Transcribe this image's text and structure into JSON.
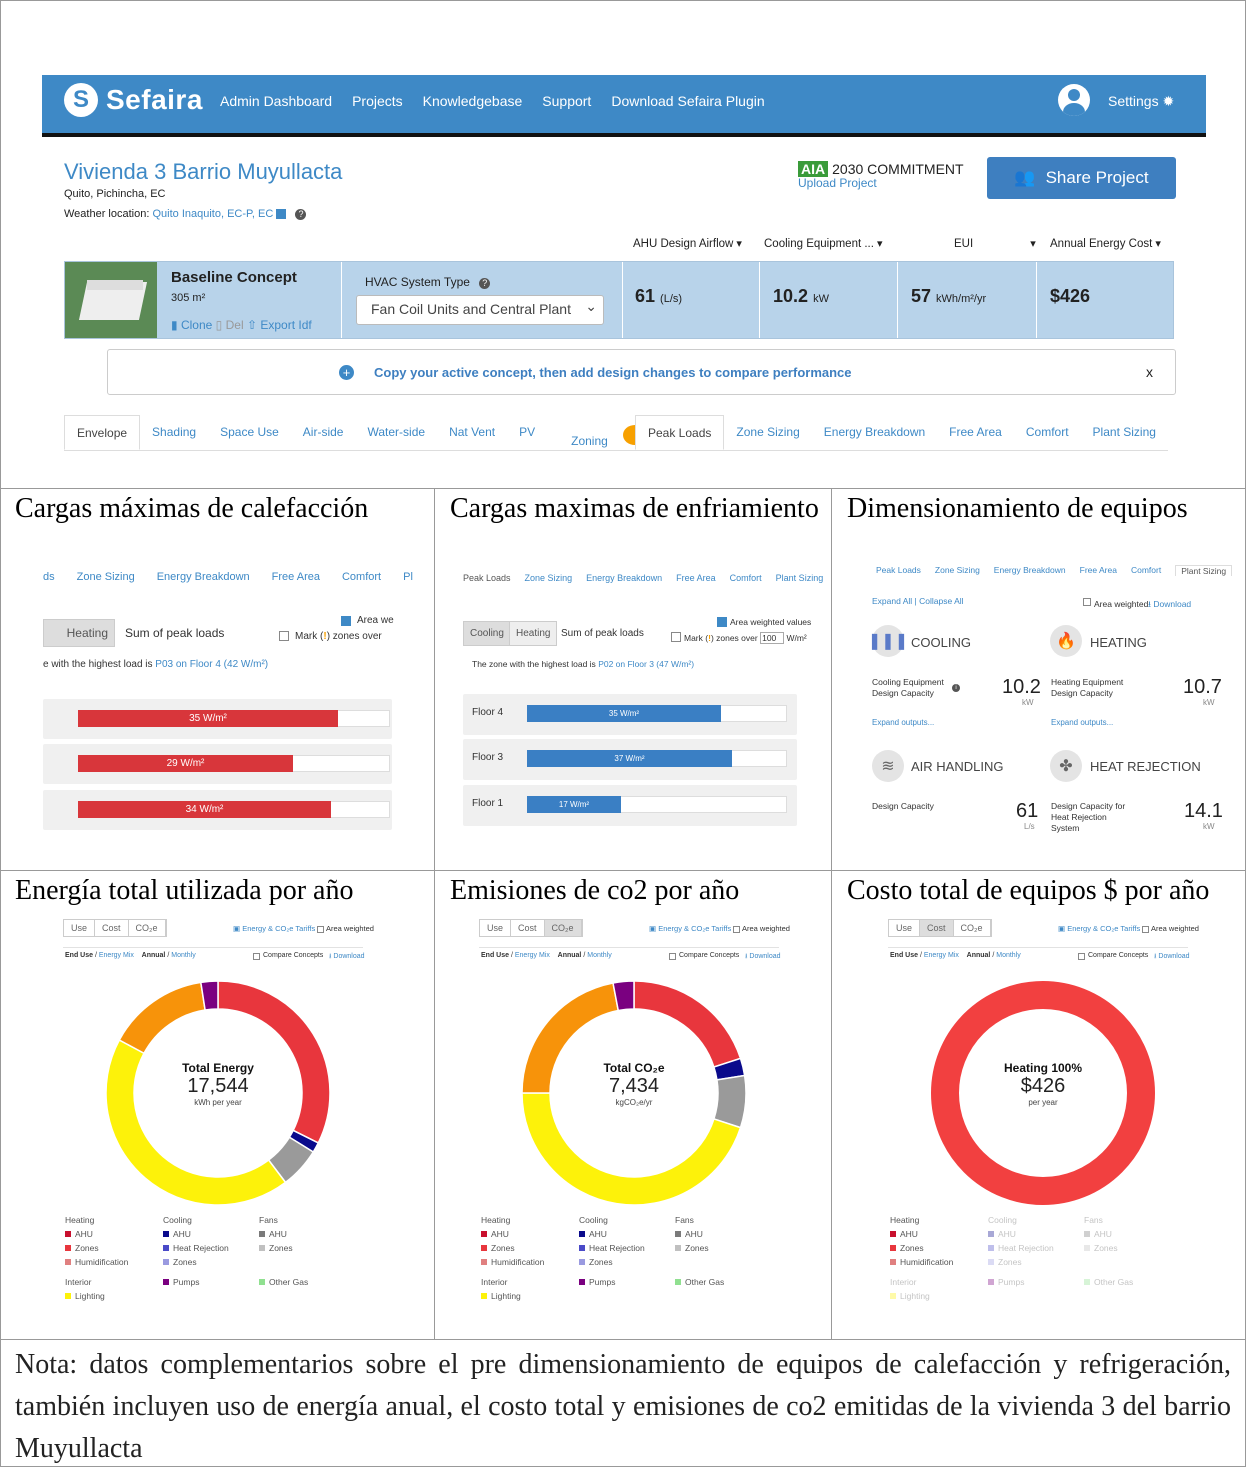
{
  "nav": {
    "brand": "Sefaira",
    "links": [
      "Admin Dashboard",
      "Projects",
      "Knowledgebase",
      "Support",
      "Download Sefaira Plugin"
    ],
    "settings": "Settings"
  },
  "project": {
    "title": "Vivienda 3 Barrio Muyullacta",
    "location": "Quito, Pichincha, EC",
    "weather_label": "Weather location:",
    "weather_value": "Quito Inaquito, EC-P, EC",
    "aia_badge": "AIA",
    "aia_text": "2030 COMMITMENT",
    "upload": "Upload Project",
    "share": "Share Project"
  },
  "metrics_headers": [
    "AHU Design Airflow",
    "Cooling Equipment ...",
    "EUI",
    "Annual Energy Cost"
  ],
  "concept": {
    "name": "Baseline Concept",
    "area": "305 m²",
    "clone": "Clone",
    "del": "Del",
    "export": "Export Idf",
    "hvac_label": "HVAC System Type",
    "hvac_value": "Fan Coil Units and Central Plant",
    "m1": "61",
    "m1_unit": "(L/s)",
    "m2": "10.2",
    "m2_unit": "kW",
    "m3": "57",
    "m3_unit": "kWh/m²/yr",
    "m4": "$426"
  },
  "banner": "Copy your active concept, then add design changes to compare performance",
  "banner_close": "x",
  "tabs_left": [
    "Envelope",
    "Shading",
    "Space Use",
    "Air-side",
    "Water-side",
    "Nat Vent",
    "PV",
    "Zoning"
  ],
  "tabs_right": [
    "Peak Loads",
    "Zone Sizing",
    "Energy Breakdown",
    "Free Area",
    "Comfort",
    "Plant Sizing"
  ],
  "cells": {
    "heating_title": "Cargas máximas de calefacción",
    "cooling_title": "Cargas maximas de enfriamiento",
    "sizing_title": "Dimensionamiento de equipos",
    "energy_title": "Energía total utilizada por año",
    "co2_title": "Emisiones de co2 por año",
    "cost_title": "Costo total de equipos $ por año"
  },
  "heating_panel": {
    "tabs": [
      "ds",
      "Zone Sizing",
      "Energy Breakdown",
      "Free Area",
      "Comfort",
      "Pl"
    ],
    "toggle": "Heating",
    "sum": "Sum of peak loads",
    "area_weighted": "Area we",
    "mark": "Mark (",
    "mark2": ") zones over",
    "highest_prefix": "e with the highest load is",
    "highest_link": "P03 on Floor 4 (42 W/m²)",
    "bars": [
      {
        "label": "35 W/m²",
        "value": 35
      },
      {
        "label": "29 W/m²",
        "value": 29
      },
      {
        "label": "34 W/m²",
        "value": 34
      }
    ]
  },
  "cooling_panel": {
    "tabs": [
      "Peak Loads",
      "Zone Sizing",
      "Energy Breakdown",
      "Free Area",
      "Comfort",
      "Plant Sizing"
    ],
    "toggle_cool": "Cooling",
    "toggle_heat": "Heating",
    "sum": "Sum of peak loads",
    "area_weighted": "Area weighted values",
    "mark": "Mark (",
    "mark2": ") zones over",
    "threshold": "100",
    "unit": "W/m²",
    "highest_prefix": "The zone with the highest load is",
    "highest_link": "P02 on Floor 3 (47 W/m²)",
    "rows": [
      {
        "floor": "Floor 4",
        "label": "35 W/m²",
        "value": 35
      },
      {
        "floor": "Floor 3",
        "label": "37 W/m²",
        "value": 37
      },
      {
        "floor": "Floor 1",
        "label": "17 W/m²",
        "value": 17
      }
    ]
  },
  "sizing_panel": {
    "tabs": [
      "Peak Loads",
      "Zone Sizing",
      "Energy Breakdown",
      "Free Area",
      "Comfort",
      "Plant Sizing"
    ],
    "expand": "Expand All | Collapse All",
    "area_weighted": "Area weighted",
    "download": "Download",
    "cooling": "COOLING",
    "heating": "HEATING",
    "cool_lbl": "Cooling Equipment Design Capacity",
    "cool_val": "10.2",
    "cool_unit": "kW",
    "heat_lbl": "Heating Equipment Design Capacity",
    "heat_val": "10.7",
    "heat_unit": "kW",
    "expand_out": "Expand outputs...",
    "air": "AIR HANDLING",
    "rej": "HEAT REJECTION",
    "air_lbl": "Design Capacity",
    "air_val": "61",
    "air_unit": "L/s",
    "rej_lbl": "Design Capacity for Heat Rejection System",
    "rej_val": "14.1",
    "rej_unit": "kW"
  },
  "donut_common": {
    "toggles": [
      "Use",
      "Cost",
      "CO₂e"
    ],
    "tariffs": "Energy & CO₂e Tariffs",
    "area_weighted": "Area weighted",
    "enduse": "End Use",
    "energymix": "Energy Mix",
    "annual": "Annual",
    "monthly": "Monthly",
    "compare": "Compare Concepts",
    "download": "Download",
    "legend": {
      "heating": "Heating",
      "cooling": "Cooling",
      "fans": "Fans",
      "ahu": "AHU",
      "zones": "Zones",
      "humid": "Humidification",
      "heatrej": "Heat Rejection",
      "interior": "Interior",
      "lighting": "Lighting",
      "pumps": "Pumps",
      "othergas": "Other Gas"
    }
  },
  "donut_energy": {
    "title": "Total Energy",
    "value": "17,544",
    "unit": "kWh per year"
  },
  "donut_co2": {
    "title": "Total CO₂e",
    "value": "7,434",
    "unit": "kgCO₂e/yr"
  },
  "donut_cost": {
    "title": "Heating 100%",
    "value": "$426",
    "unit": "per year"
  },
  "chart_data": [
    {
      "type": "pie",
      "title": "Total Energy",
      "labels": [
        "Heating Zones",
        "Heating AHU",
        "Fans AHU",
        "Interior Lighting",
        "Other Gas",
        "Pumps"
      ],
      "values": [
        33,
        1.5,
        6,
        44,
        15,
        2.5
      ],
      "colors": [
        "#e8363d",
        "#0a0a8c",
        "#9a9a9a",
        "#fdf20a",
        "#f7930a",
        "#7a0080"
      ]
    },
    {
      "type": "pie",
      "title": "Total CO₂e",
      "labels": [
        "Heating Zones",
        "Heating AHU",
        "Fans AHU",
        "Interior Lighting",
        "Other Gas",
        "Pumps"
      ],
      "values": [
        20,
        2.5,
        7.5,
        45,
        22,
        3
      ],
      "colors": [
        "#e8363d",
        "#0a0a8c",
        "#9a9a9a",
        "#fdf20a",
        "#f7930a",
        "#7a0080"
      ]
    },
    {
      "type": "pie",
      "title": "Heating 100%",
      "labels": [
        "Heating"
      ],
      "values": [
        100
      ],
      "colors": [
        "#f24040"
      ]
    }
  ],
  "note": "Nota: datos complementarios sobre el pre dimensionamiento de equipos de calefacción y refrigeración, también incluyen uso de energía anual, el costo total y emisiones de co2 emitidas de la vivienda 3 del barrio Muyullacta"
}
